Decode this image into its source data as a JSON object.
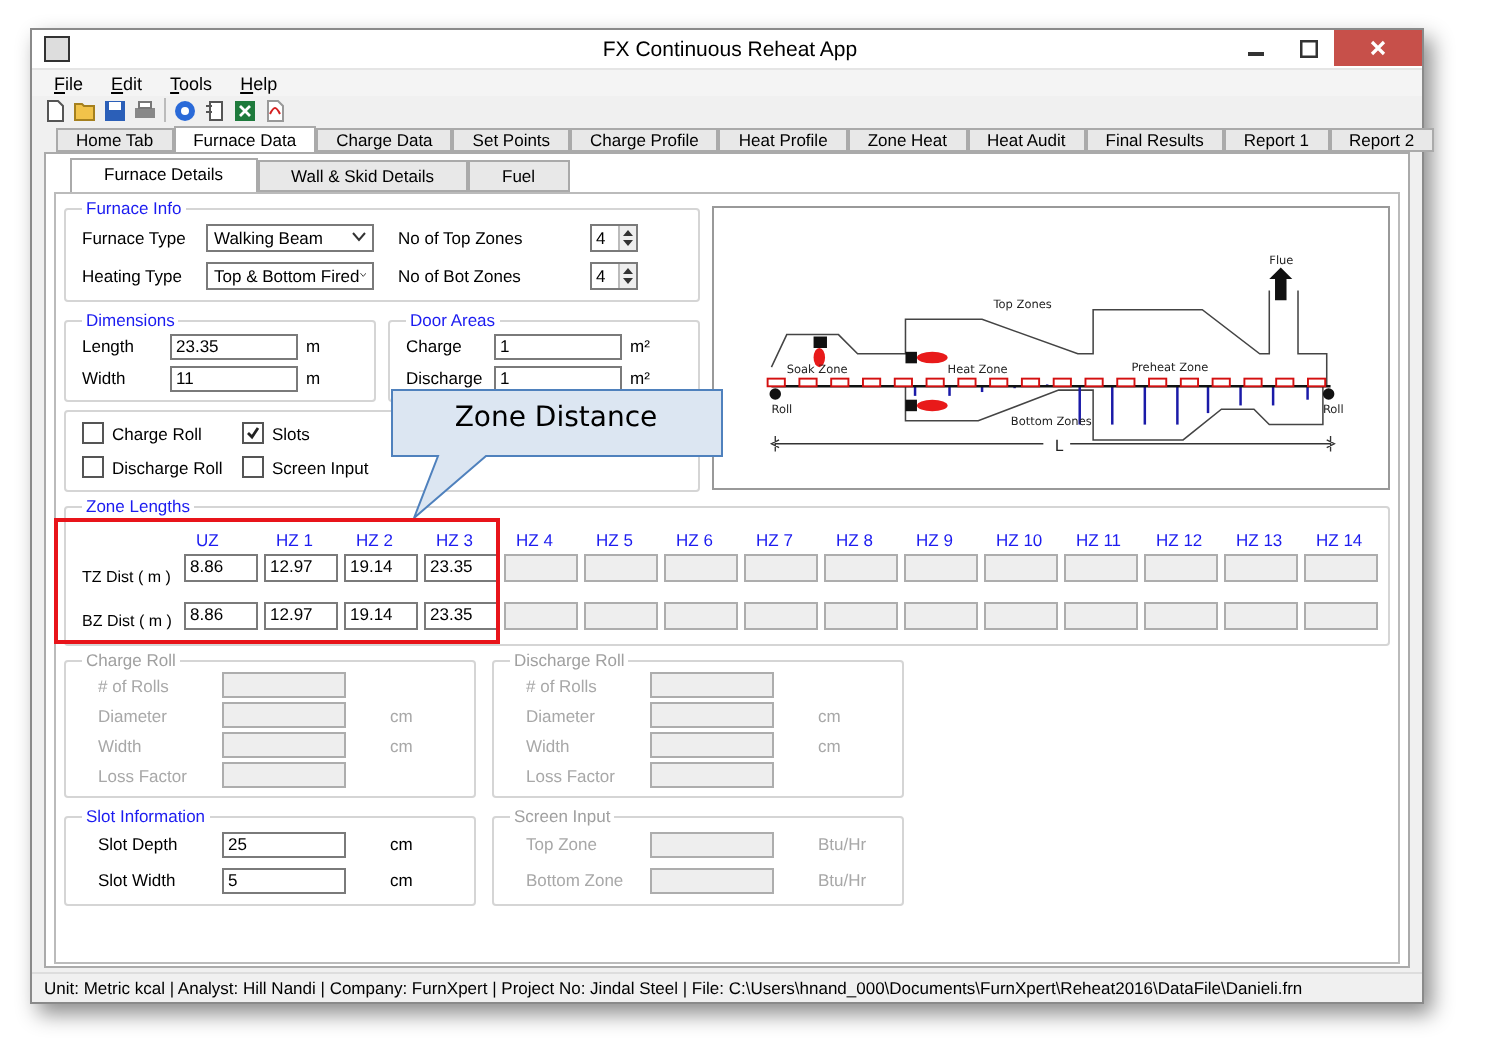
{
  "window": {
    "title": "FX Continuous Reheat App"
  },
  "menu": [
    "File",
    "Edit",
    "Tools",
    "Help"
  ],
  "tabs": [
    {
      "label": "Home Tab",
      "selected": false
    },
    {
      "label": "Furnace Data",
      "selected": true
    },
    {
      "label": "Charge Data",
      "selected": false
    },
    {
      "label": "Set Points",
      "selected": false
    },
    {
      "label": "Charge Profile",
      "selected": false
    },
    {
      "label": "Heat Profile",
      "selected": false
    },
    {
      "label": "Zone Heat",
      "selected": false
    },
    {
      "label": "Heat Audit",
      "selected": false
    },
    {
      "label": "Final Results",
      "selected": false
    },
    {
      "label": "Report 1",
      "selected": false
    },
    {
      "label": "Report 2",
      "selected": false
    }
  ],
  "subtabs": [
    {
      "label": "Furnace Details",
      "selected": true
    },
    {
      "label": "Wall & Skid Details",
      "selected": false
    },
    {
      "label": "Fuel",
      "selected": false
    }
  ],
  "furnace_info": {
    "title": "Furnace Info",
    "furnace_type": {
      "label": "Furnace Type",
      "value": "Walking Beam"
    },
    "heating_type": {
      "label": "Heating Type",
      "value": "Top & Bottom Fired"
    },
    "top_zones": {
      "label": "No of Top Zones",
      "value": "4"
    },
    "bot_zones": {
      "label": "No of Bot Zones",
      "value": "4"
    }
  },
  "dimensions": {
    "title": "Dimensions",
    "fields": [
      {
        "label": "Length",
        "value": "23.35",
        "unit": "m"
      },
      {
        "label": "Width",
        "value": "11",
        "unit": "m"
      }
    ]
  },
  "door_areas": {
    "title": "Door Areas",
    "fields": [
      {
        "label": "Charge",
        "value": "1",
        "unit": "m²"
      },
      {
        "label": "Discharge",
        "value": "1",
        "unit": "m²"
      }
    ]
  },
  "options": [
    {
      "label": "Charge Roll",
      "checked": false
    },
    {
      "label": "Slots",
      "checked": true
    },
    {
      "label": "Discharge Roll",
      "checked": false
    },
    {
      "label": "Screen Input",
      "checked": false
    }
  ],
  "diagram": {
    "labels": [
      "Soak Zone",
      "Heat Zone",
      "Top Zones",
      "Preheat Zone",
      "Bottom Zones",
      "Flue",
      "Roll",
      "Roll",
      "L"
    ]
  },
  "zone_lengths": {
    "title": "Zone Lengths",
    "row_labels": [
      "TZ Dist ( m )",
      "BZ Dist ( m )"
    ],
    "zones": [
      {
        "label": "UZ",
        "disabled": false,
        "tz": "8.86",
        "bz": "8.86"
      },
      {
        "label": "HZ 1",
        "disabled": false,
        "tz": "12.97",
        "bz": "12.97"
      },
      {
        "label": "HZ 2",
        "disabled": false,
        "tz": "19.14",
        "bz": "19.14"
      },
      {
        "label": "HZ 3",
        "disabled": false,
        "tz": "23.35",
        "bz": "23.35"
      },
      {
        "label": "HZ 4",
        "disabled": true
      },
      {
        "label": "HZ 5",
        "disabled": true
      },
      {
        "label": "HZ 6",
        "disabled": true
      },
      {
        "label": "HZ 7",
        "disabled": true
      },
      {
        "label": "HZ 8",
        "disabled": true
      },
      {
        "label": "HZ 9",
        "disabled": true
      },
      {
        "label": "HZ 10",
        "disabled": true
      },
      {
        "label": "HZ 11",
        "disabled": true
      },
      {
        "label": "HZ 12",
        "disabled": true
      },
      {
        "label": "HZ 13",
        "disabled": true
      },
      {
        "label": "HZ 14",
        "disabled": true
      }
    ]
  },
  "groups": [
    {
      "title": "Charge Roll",
      "disabled": true,
      "fields": [
        {
          "label": "# of Rolls"
        },
        {
          "label": "Diameter",
          "unit": "cm"
        },
        {
          "label": "Width",
          "unit": "cm"
        },
        {
          "label": "Loss Factor"
        }
      ]
    },
    {
      "title": "Discharge Roll",
      "disabled": true,
      "fields": [
        {
          "label": "# of Rolls"
        },
        {
          "label": "Diameter",
          "unit": "cm"
        },
        {
          "label": "Width",
          "unit": "cm"
        },
        {
          "label": "Loss Factor"
        }
      ]
    },
    {
      "title": "Slot Information",
      "disabled": false,
      "fields": [
        {
          "label": "Slot  Depth",
          "value": "25",
          "unit": "cm"
        },
        {
          "label": "Slot Width",
          "value": "5",
          "unit": "cm"
        }
      ]
    },
    {
      "title": "Screen Input",
      "disabled": true,
      "fields": [
        {
          "label": "Top Zone",
          "unit": "Btu/Hr"
        },
        {
          "label": "Bottom Zone",
          "unit": "Btu/Hr"
        }
      ]
    }
  ],
  "callout": "Zone Distance",
  "status_bar": "Unit:  Metric kcal  | Analyst: Hill Nandi  | Company: FurnXpert  | Project No: Jindal Steel  | File: C:\\Users\\hnand_000\\Documents\\FurnXpert\\Reheat2016\\DataFile\\Danieli.frn"
}
